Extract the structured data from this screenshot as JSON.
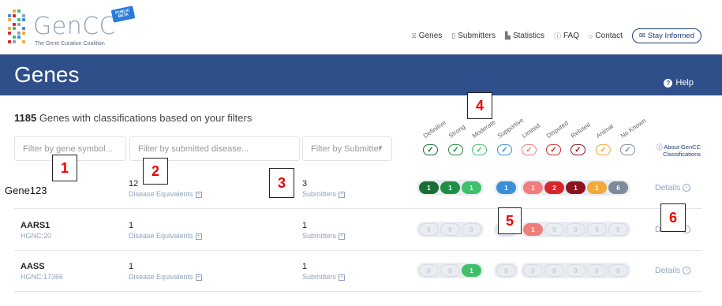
{
  "header": {
    "logo_text": "GenCC",
    "logo_subtitle": "The Gene Curation Coalition",
    "logo_badge": "PUBLIC BETA",
    "nav": [
      {
        "label": "Genes",
        "icon": "dna-icon"
      },
      {
        "label": "Submitters",
        "icon": "document-icon"
      },
      {
        "label": "Statistics",
        "icon": "bar-chart-icon"
      },
      {
        "label": "FAQ",
        "icon": "question-circle-icon"
      },
      {
        "label": "Contact",
        "icon": "chat-bubble-icon"
      }
    ],
    "stay_informed": "Stay Informed"
  },
  "banner": {
    "title": "Genes",
    "help": "Help"
  },
  "summary": {
    "count": "1185",
    "text": " Genes with classifications based on your filters"
  },
  "filters": {
    "gene_placeholder": "Filter by gene symbol...",
    "disease_placeholder": "Filter by submitted disease...",
    "submitter_placeholder": "Filter by Submitter"
  },
  "classifications": [
    {
      "label": "Definitive",
      "color": "#1a6e35"
    },
    {
      "label": "Strong",
      "color": "#1f8f45"
    },
    {
      "label": "Moderate",
      "color": "#3fbf6a"
    },
    {
      "label": "Supportive",
      "color": "#3a8fd6"
    },
    {
      "label": "Limited",
      "color": "#f07c7c"
    },
    {
      "label": "Disputed",
      "color": "#d6262c"
    },
    {
      "label": "Refuted",
      "color": "#8c1420"
    },
    {
      "label": "Animal",
      "color": "#f2a93b"
    },
    {
      "label": "No Known",
      "color": "#7f8a9a"
    }
  ],
  "about": "About GenCC Classifications",
  "rows": [
    {
      "name": "",
      "id": "",
      "diseases": "12",
      "diseases_label": "Disease Equivalents",
      "submitters": "3",
      "submitters_label": "Submitters",
      "values": [
        "1",
        "1",
        "1",
        "1",
        "1",
        "2",
        "1",
        "1",
        "6"
      ],
      "details": "Details"
    },
    {
      "name": "AARS1",
      "id": "HGNC:20",
      "diseases": "1",
      "diseases_label": "Disease Equivalents",
      "submitters": "1",
      "submitters_label": "Submitters",
      "values": [
        "0",
        "0",
        "0",
        "0",
        "1",
        "0",
        "0",
        "0",
        "0"
      ],
      "details": "Details"
    },
    {
      "name": "AASS",
      "id": "HGNC:17366",
      "diseases": "1",
      "diseases_label": "Disease Equivalents",
      "submitters": "1",
      "submitters_label": "Submitters",
      "values": [
        "0",
        "0",
        "1",
        "0",
        "0",
        "0",
        "0",
        "0",
        "0"
      ],
      "details": "Details"
    }
  ],
  "annotations": {
    "gene_label": "Gene123",
    "markers": [
      "1",
      "2",
      "3",
      "4",
      "5",
      "6"
    ]
  }
}
